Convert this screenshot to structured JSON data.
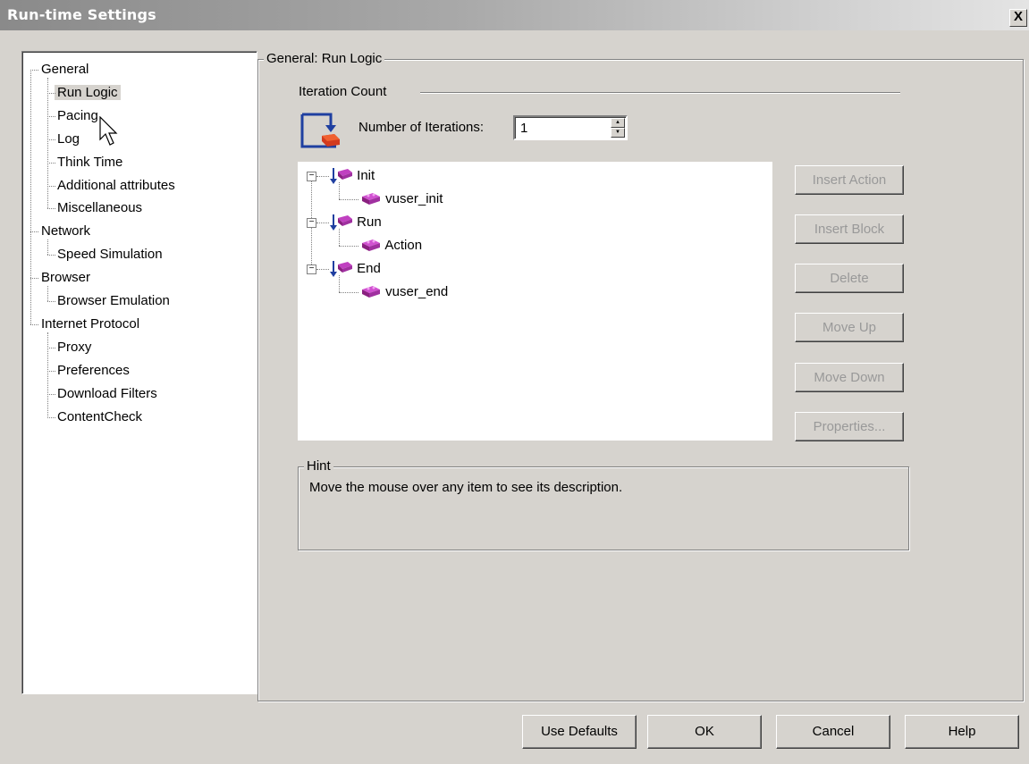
{
  "window": {
    "title": "Run-time Settings",
    "close_glyph": "X"
  },
  "tree": {
    "items": [
      {
        "label": "General",
        "level": 0,
        "selected": false
      },
      {
        "label": "Run Logic",
        "level": 1,
        "selected": true
      },
      {
        "label": "Pacing",
        "level": 1,
        "selected": false
      },
      {
        "label": "Log",
        "level": 1,
        "selected": false
      },
      {
        "label": "Think Time",
        "level": 1,
        "selected": false
      },
      {
        "label": "Additional attributes",
        "level": 1,
        "selected": false
      },
      {
        "label": "Miscellaneous",
        "level": 1,
        "selected": false
      },
      {
        "label": "Network",
        "level": 0,
        "selected": false
      },
      {
        "label": "Speed Simulation",
        "level": 1,
        "selected": false
      },
      {
        "label": "Browser",
        "level": 0,
        "selected": false
      },
      {
        "label": "Browser Emulation",
        "level": 1,
        "selected": false
      },
      {
        "label": "Internet Protocol",
        "level": 0,
        "selected": false
      },
      {
        "label": "Proxy",
        "level": 1,
        "selected": false
      },
      {
        "label": "Preferences",
        "level": 1,
        "selected": false
      },
      {
        "label": "Download Filters",
        "level": 1,
        "selected": false
      },
      {
        "label": "ContentCheck",
        "level": 1,
        "selected": false
      }
    ]
  },
  "main": {
    "group_title": "General: Run Logic",
    "iteration_section": "Iteration Count",
    "iterations_label": "Number of Iterations:",
    "iterations_value": "1",
    "script_tree": [
      {
        "label": "Init",
        "type": "block",
        "children": [
          "vuser_init"
        ]
      },
      {
        "label": "Run",
        "type": "block",
        "children": [
          "Action"
        ]
      },
      {
        "label": "End",
        "type": "block",
        "children": [
          "vuser_end"
        ]
      }
    ],
    "side_buttons": [
      "Insert Action",
      "Insert Block",
      "Delete",
      "Move Up",
      "Move Down",
      "Properties..."
    ],
    "hint_title": "Hint",
    "hint_text": "Move the mouse over any item to see its description."
  },
  "footer": {
    "use_defaults": "Use Defaults",
    "ok": "OK",
    "cancel": "Cancel",
    "help": "Help"
  },
  "colors": {
    "dialog_bg": "#d6d3ce",
    "icon_blue": "#1f3fa0",
    "icon_red": "#d23a1e",
    "icon_magenta": "#c040c0"
  }
}
